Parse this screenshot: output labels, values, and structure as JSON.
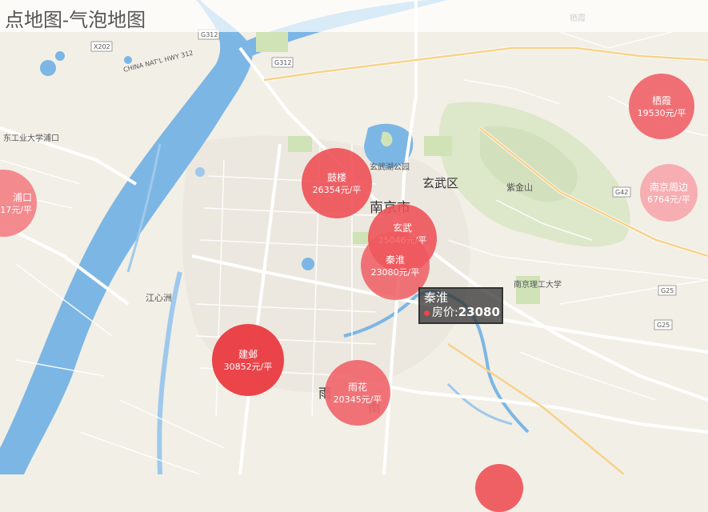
{
  "title": "点地图-气泡地图",
  "colors": {
    "bubble_strong": "#ee4449",
    "bubble_mid": "#f1646a",
    "bubble_light": "#f6a6ac",
    "river": "#7cb6e4",
    "land": "#f2efe6"
  },
  "map_labels": {
    "district": "玄武区",
    "city": "南京市",
    "mountain": "紫金山",
    "university": "南京理工大学",
    "island": "江心洲",
    "park": "玄武湖公园",
    "campus": "东工业大学浦口",
    "road_g312": "G312",
    "road_x202": "X202",
    "road_g42": "G42",
    "road_g25": "G25",
    "hwy": "CHINA NAT'L HWY 312",
    "town": "栖霞",
    "partial_yu": "雨",
    "partial_nan": "南"
  },
  "bubbles": [
    {
      "name": "鼓楼",
      "value_text": "26354元/平"
    },
    {
      "name": "玄武",
      "value_text": "25046元/平"
    },
    {
      "name": "秦淮",
      "value_text": "23080元/平"
    },
    {
      "name": "建邺",
      "value_text": "30852元/平"
    },
    {
      "name": "雨花",
      "value_text": "20345元/平"
    },
    {
      "name": "栖霞",
      "value_text": "19530元/平"
    },
    {
      "name": "南京周边",
      "value_text": "6764元/平"
    },
    {
      "name": "浦口",
      "value_text": "17元/平"
    }
  ],
  "tooltip": {
    "name": "秦淮",
    "label": "房价:",
    "value": "23080"
  }
}
